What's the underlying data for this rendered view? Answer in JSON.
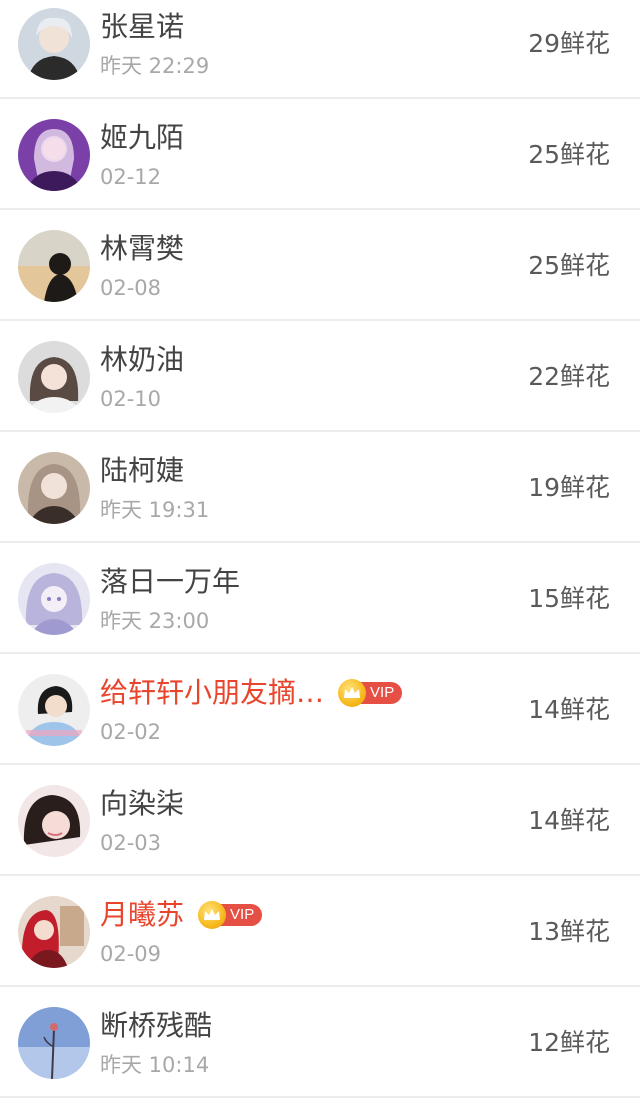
{
  "rank_list": {
    "items": [
      {
        "name": "张星诺",
        "time": "昨天 22:29",
        "flowers": "29鲜花",
        "vip": false,
        "avatar": "avatar-1"
      },
      {
        "name": "姬九陌",
        "time": "02-12",
        "flowers": "25鲜花",
        "vip": false,
        "avatar": "avatar-2"
      },
      {
        "name": "林霄樊",
        "time": "02-08",
        "flowers": "25鲜花",
        "vip": false,
        "avatar": "avatar-3"
      },
      {
        "name": "林奶油",
        "time": "02-10",
        "flowers": "22鲜花",
        "vip": false,
        "avatar": "avatar-4"
      },
      {
        "name": "陆柯婕",
        "time": "昨天 19:31",
        "flowers": "19鲜花",
        "vip": false,
        "avatar": "avatar-5"
      },
      {
        "name": "落日一万年",
        "time": "昨天 23:00",
        "flowers": "15鲜花",
        "vip": false,
        "avatar": "avatar-6"
      },
      {
        "name": "给轩轩小朋友摘…",
        "time": "02-02",
        "flowers": "14鲜花",
        "vip": true,
        "vip_label": "VIP",
        "avatar": "avatar-7"
      },
      {
        "name": "向染柒",
        "time": "02-03",
        "flowers": "14鲜花",
        "vip": false,
        "avatar": "avatar-8"
      },
      {
        "name": "月曦苏",
        "time": "02-09",
        "flowers": "13鲜花",
        "vip": true,
        "vip_label": "VIP",
        "avatar": "avatar-9"
      },
      {
        "name": "断桥残酷",
        "time": "昨天 10:14",
        "flowers": "12鲜花",
        "vip": false,
        "avatar": "avatar-10"
      }
    ]
  },
  "colors": {
    "vip_name": "#e8452c",
    "vip_tag": "#e64f44",
    "crown": "#f7b91d",
    "name": "#444444",
    "time": "#a8a8a8",
    "count": "#5a5a5a",
    "divider": "#ececec"
  }
}
